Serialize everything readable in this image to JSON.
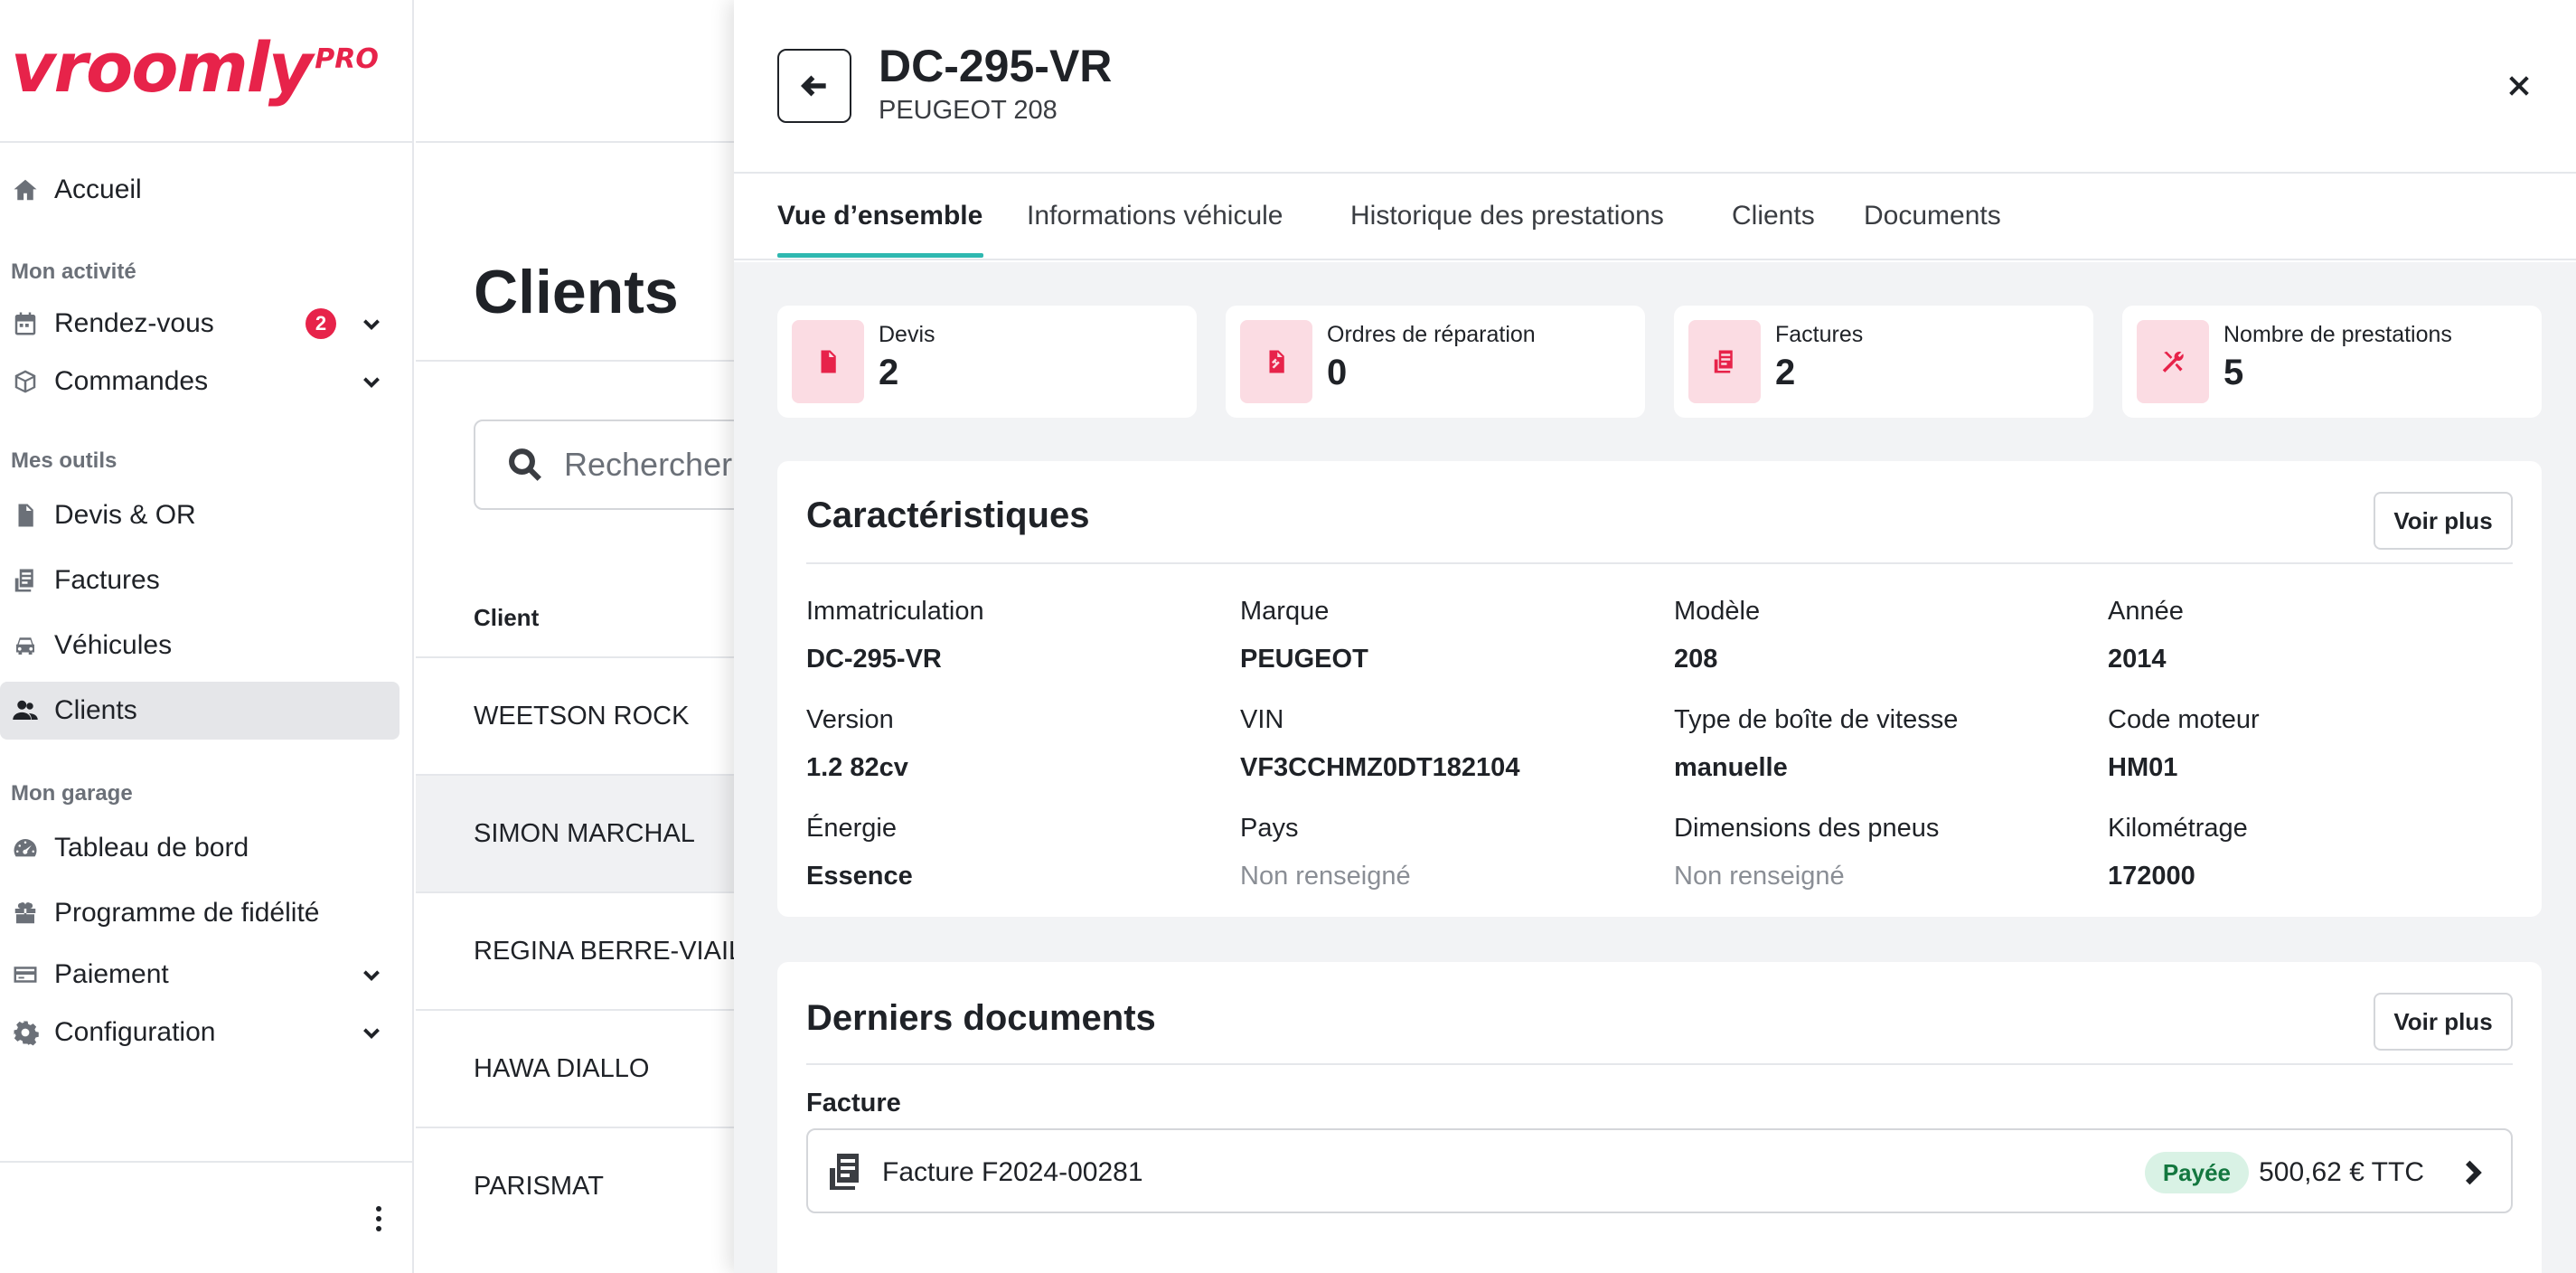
{
  "brand": {
    "name": "vroomly",
    "suffix": "PRO",
    "color": "#e7234a"
  },
  "sidebar": {
    "home": {
      "label": "Accueil",
      "icon": "home-icon"
    },
    "sections": [
      {
        "title": "Mon activité"
      },
      {
        "title": "Mes outils"
      },
      {
        "title": "Mon garage"
      }
    ],
    "items": [
      {
        "label": "Rendez-vous",
        "icon": "calendar-icon",
        "badge": "2",
        "expandable": true
      },
      {
        "label": "Commandes",
        "icon": "box-icon",
        "expandable": true
      },
      {
        "label": "Devis & OR",
        "icon": "document-icon"
      },
      {
        "label": "Factures",
        "icon": "invoice-icon"
      },
      {
        "label": "Véhicules",
        "icon": "car-icon"
      },
      {
        "label": "Clients",
        "icon": "users-icon",
        "active": true
      },
      {
        "label": "Tableau de bord",
        "icon": "dashboard-icon"
      },
      {
        "label": "Programme de fidélité",
        "icon": "gift-icon"
      },
      {
        "label": "Paiement",
        "icon": "card-icon",
        "expandable": true
      },
      {
        "label": "Configuration",
        "icon": "gear-icon",
        "expandable": true
      }
    ]
  },
  "clients_page": {
    "title": "Clients",
    "search_placeholder": "Rechercher",
    "column_client": "Client",
    "rows": [
      "WEETSON ROCK",
      "SIMON MARCHAL",
      "REGINA BERRE-VIAIL",
      "HAWA DIALLO",
      "PARISMAT"
    ]
  },
  "drawer": {
    "plate": "DC-295-VR",
    "model": "PEUGEOT 208",
    "tabs": [
      "Vue d’ensemble",
      "Informations véhicule",
      "Historique des prestations",
      "Clients",
      "Documents"
    ],
    "active_tab": 0,
    "accent": "#2fb8b0",
    "stats": [
      {
        "label": "Devis",
        "value": "2",
        "icon": "quote-doc-icon"
      },
      {
        "label": "Ordres de réparation",
        "value": "0",
        "icon": "repair-order-icon"
      },
      {
        "label": "Factures",
        "value": "2",
        "icon": "invoice-icon"
      },
      {
        "label": "Nombre de prestations",
        "value": "5",
        "icon": "tools-icon"
      }
    ],
    "characteristics": {
      "title": "Caractéristiques",
      "more": "Voir plus",
      "fields": [
        {
          "label": "Immatriculation",
          "value": "DC-295-VR"
        },
        {
          "label": "Marque",
          "value": "PEUGEOT"
        },
        {
          "label": "Modèle",
          "value": "208"
        },
        {
          "label": "Année",
          "value": "2014"
        },
        {
          "label": "Version",
          "value": "1.2 82cv"
        },
        {
          "label": "VIN",
          "value": "VF3CCHMZ0DT182104"
        },
        {
          "label": "Type de boîte de vitesse",
          "value": "manuelle"
        },
        {
          "label": "Code moteur",
          "value": "HM01"
        },
        {
          "label": "Énergie",
          "value": "Essence"
        },
        {
          "label": "Pays",
          "value": "Non renseigné",
          "muted": true
        },
        {
          "label": "Dimensions des pneus",
          "value": "Non renseigné",
          "muted": true
        },
        {
          "label": "Kilométrage",
          "value": "172000"
        }
      ]
    },
    "documents": {
      "title": "Derniers documents",
      "more": "Voir plus",
      "section": "Facture",
      "items": [
        {
          "name": "Facture F2024-00281",
          "status": "Payée",
          "amount": "500,62 € TTC"
        }
      ]
    }
  }
}
